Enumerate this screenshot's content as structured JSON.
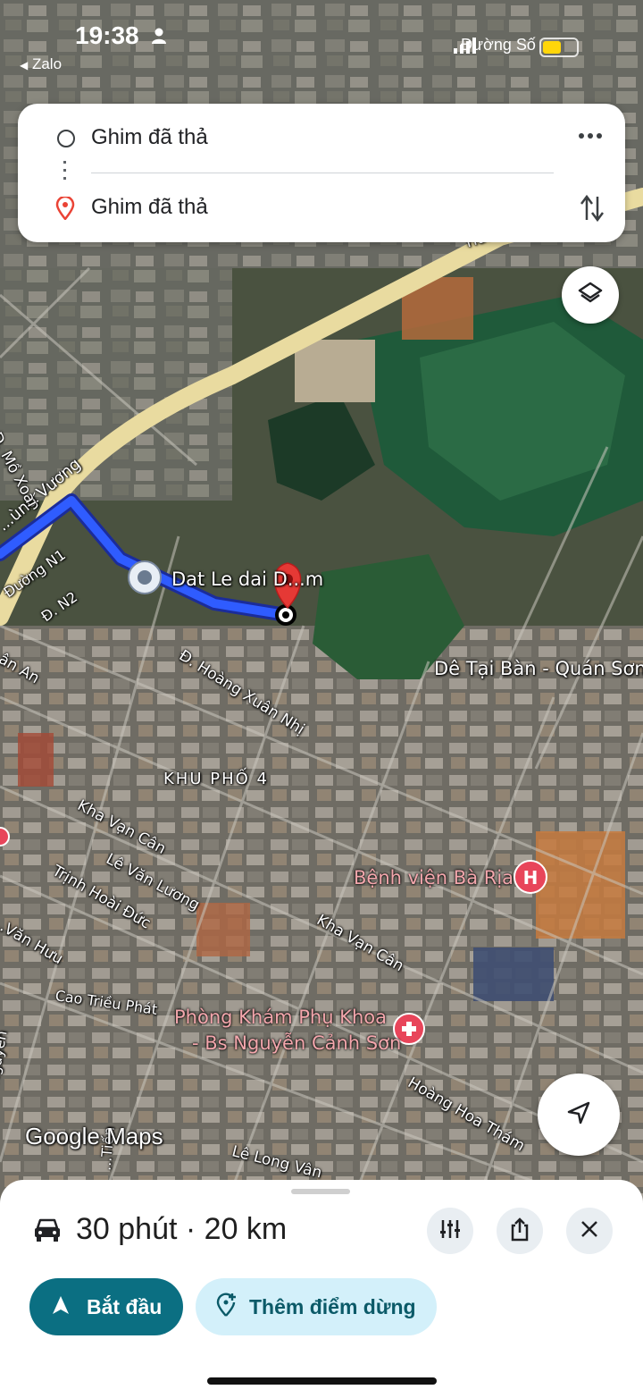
{
  "status_bar": {
    "time": "19:38",
    "back_app": "Zalo",
    "carrier": "Đường Số",
    "battery_level": 0.6
  },
  "directions": {
    "origin": "Ghim đã thả",
    "destination": "Ghim đã thả",
    "more_icon": "more-vert-icon",
    "swap_icon": "swap-vert-icon"
  },
  "map": {
    "route_color": "#2f5cff",
    "highway_label": "...ùng Vương",
    "highway_top_label": "Hù...",
    "place_label": "Dat Le dai D...m",
    "road_labels": {
      "mo_xoai": "Đ. Mồ Xoài",
      "n1": "Đường N1",
      "n2": "Đ. N2",
      "van_an": "...ân An",
      "hoang_xuan_nhi": "Đ. Hoàng Xuân Nhị",
      "khu_pho": "KHU PHỐ 4",
      "kha_van_can_1": "Kha Vạn Cân",
      "le_van_luong": "Lê Văn Lương",
      "trinh_hoai_duc": "Trịnh Hoài Đức",
      "van_huu": "...Văn Hưu",
      "kha_van_can_2": "Kha Vạn Cân",
      "cao_trieu_phat": "Cao Triều Phát",
      "hoang_hoa_tham": "Hoàng Hoa Thám",
      "le_long_van": "Lê Long Vân",
      "nguyen": "...n Văn Nguyễn",
      "tien": "...Tiến"
    },
    "poi": {
      "restaurant": "Dê Tại Bàn - Quán Sơn",
      "hospital": "Bệnh viện Bà Rịa",
      "clinic_line1": "Phòng Khám Phụ Khoa",
      "clinic_line2": "- Bs Nguyễn Cảnh Sơn"
    },
    "attribution": "Google Maps"
  },
  "sheet": {
    "mode_icon": "car-icon",
    "eta": "30 phút · 20 km",
    "options_icon": "tune-icon",
    "share_icon": "share-icon",
    "close_icon": "close-icon",
    "start_label": "Bắt đầu",
    "add_stop_label": "Thêm điểm dừng"
  }
}
